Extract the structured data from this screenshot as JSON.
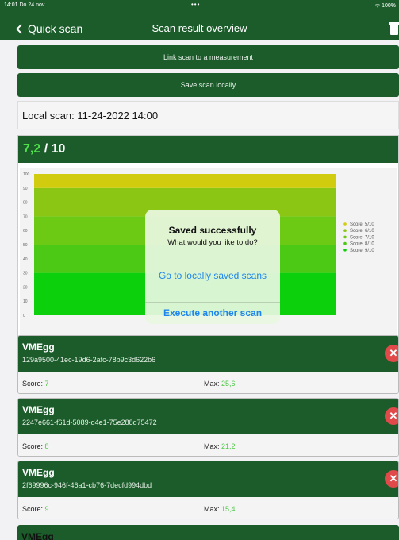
{
  "status_bar": {
    "time_date": "14:01 Do 24 nov.",
    "dots": "•••",
    "battery": "100%"
  },
  "nav": {
    "back_label": "Quick scan",
    "title": "Scan result overview"
  },
  "actions": {
    "link_label": "Link scan to a measurement",
    "save_label": "Save scan locally"
  },
  "local_scan": "Local scan: 11-24-2022 14:00",
  "score": {
    "value": "7,2",
    "separator": " / ",
    "max": "10"
  },
  "chart_data": {
    "type": "area",
    "yticks": [
      0,
      10,
      20,
      30,
      40,
      50,
      60,
      70,
      80,
      90,
      100
    ],
    "ylim": [
      0,
      100
    ],
    "bands": [
      {
        "name": "Score: 9/10",
        "from": 0,
        "to": 30,
        "color": "#0bd00b"
      },
      {
        "name": "Score: 8/10",
        "from": 30,
        "to": 50,
        "color": "#4bc915"
      },
      {
        "name": "Score: 7/10",
        "from": 50,
        "to": 70,
        "color": "#6cca14"
      },
      {
        "name": "Score: 6/10",
        "from": 70,
        "to": 90,
        "color": "#8cc615"
      },
      {
        "name": "Score: 5/10",
        "from": 90,
        "to": 100,
        "color": "#d2cc0e"
      }
    ],
    "legend_position": "right"
  },
  "dialog": {
    "title": "Saved successfully",
    "message": "What would you like to do?",
    "action_1": "Go to locally saved scans",
    "action_2": "Execute another scan"
  },
  "scans": [
    {
      "name": "VMEgg",
      "id": "129a9500-41ec-19d6-2afc-78b9c3d622b6",
      "score_label": "Score:",
      "score": "7",
      "max_label": "Max:",
      "max": "25,6"
    },
    {
      "name": "VMEgg",
      "id": "2247e661-f61d-5089-d4e1-75e288d75472",
      "score_label": "Score:",
      "score": "8",
      "max_label": "Max:",
      "max": "21,2"
    },
    {
      "name": "VMEgg",
      "id": "2f69996c-946f-46a1-cb76-7decfd994dbd",
      "score_label": "Score:",
      "score": "9",
      "max_label": "Max:",
      "max": "15,4"
    }
  ],
  "partial_scan": {
    "name": "VMEgg"
  },
  "icons": {
    "back": "chevron-left-icon",
    "trash": "trash-icon",
    "delete": "delete-x-icon"
  }
}
